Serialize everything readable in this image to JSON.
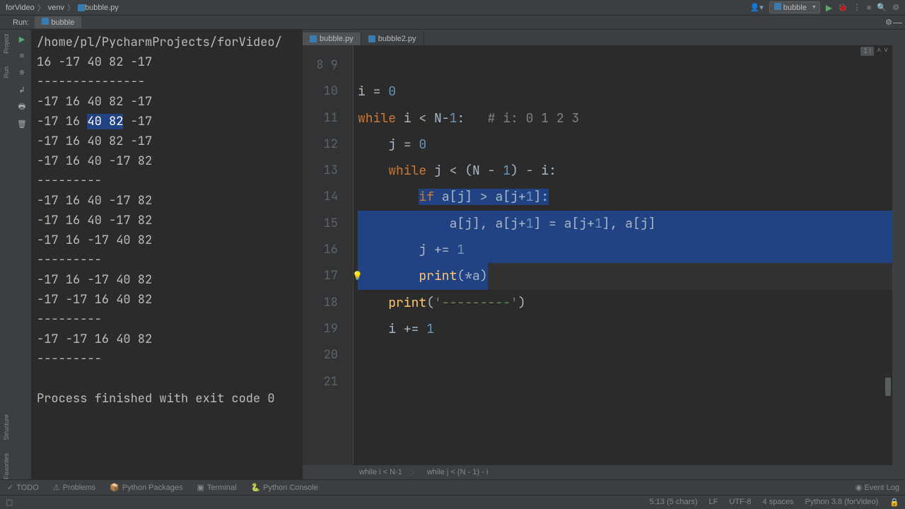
{
  "nav": {
    "crumbs": [
      "forVideo",
      "venv",
      "bubble.py"
    ],
    "config": "bubble"
  },
  "run": {
    "label": "Run:",
    "tab": "bubble"
  },
  "output": {
    "lines": [
      "/home/pl/PycharmProjects/forVideo/",
      "16 -17 40 82 -17",
      "---------------",
      "-17 16 40 82 -17",
      "-17 16 40 82 -17",
      "-17 16 40 82 -17",
      "-17 16 40 -17 82",
      "---------",
      "-17 16 40 -17 82",
      "-17 16 40 -17 82",
      "-17 16 -17 40 82",
      "---------",
      "-17 16 -17 40 82",
      "-17 -17 16 40 82",
      "---------",
      "-17 -17 16 40 82",
      "---------",
      "",
      "Process finished with exit code 0"
    ],
    "selected_line_idx": 4,
    "selected_text": "40 82"
  },
  "editor": {
    "tabs": [
      {
        "label": "bubble.py",
        "active": true
      },
      {
        "label": "bubble2.py",
        "active": false
      }
    ],
    "crumbs": [
      "while i < N-1",
      "while j < (N - 1) - i"
    ],
    "gutter_start": 8,
    "gutter_end": 21,
    "selection_lines": [
      13,
      14,
      15,
      16
    ],
    "caret_line": 16,
    "code_lines": [
      {
        "n": 8,
        "seg": [
          [
            "",
            ""
          ]
        ]
      },
      {
        "n": 9,
        "seg": [
          [
            "id",
            "i "
          ],
          [
            "op",
            "= "
          ],
          [
            "num",
            "0"
          ]
        ]
      },
      {
        "n": 10,
        "seg": [
          [
            "kw",
            "while "
          ],
          [
            "id",
            "i "
          ],
          [
            "op",
            "< "
          ],
          [
            "id",
            "N"
          ],
          [
            "op",
            "-"
          ],
          [
            "num",
            "1"
          ],
          [
            "op",
            ":   "
          ],
          [
            "cmt",
            "# i: 0 1 2 3"
          ]
        ]
      },
      {
        "n": 11,
        "seg": [
          [
            "id",
            "    j "
          ],
          [
            "op",
            "= "
          ],
          [
            "num",
            "0"
          ]
        ]
      },
      {
        "n": 12,
        "seg": [
          [
            "id",
            "    "
          ],
          [
            "kw",
            "while "
          ],
          [
            "id",
            "j "
          ],
          [
            "op",
            "< ("
          ],
          [
            "id",
            "N "
          ],
          [
            "op",
            "- "
          ],
          [
            "num",
            "1"
          ],
          [
            "op",
            ") - "
          ],
          [
            "id",
            "i"
          ],
          [
            "op",
            ":"
          ]
        ]
      },
      {
        "n": 13,
        "seg": [
          [
            "id",
            "        "
          ],
          [
            "kw",
            "if "
          ],
          [
            "id",
            "a"
          ],
          [
            "op",
            "["
          ],
          [
            "id",
            "j"
          ],
          [
            "op",
            "] > "
          ],
          [
            "id",
            "a"
          ],
          [
            "op",
            "["
          ],
          [
            "id",
            "j"
          ],
          [
            "op",
            "+"
          ],
          [
            "num",
            "1"
          ],
          [
            "op",
            "]:"
          ]
        ]
      },
      {
        "n": 14,
        "seg": [
          [
            "id",
            "            a"
          ],
          [
            "op",
            "["
          ],
          [
            "id",
            "j"
          ],
          [
            "op",
            "], "
          ],
          [
            "id",
            "a"
          ],
          [
            "op",
            "["
          ],
          [
            "id",
            "j"
          ],
          [
            "op",
            "+"
          ],
          [
            "num",
            "1"
          ],
          [
            "op",
            "] = "
          ],
          [
            "id",
            "a"
          ],
          [
            "op",
            "["
          ],
          [
            "id",
            "j"
          ],
          [
            "op",
            "+"
          ],
          [
            "num",
            "1"
          ],
          [
            "op",
            "], "
          ],
          [
            "id",
            "a"
          ],
          [
            "op",
            "["
          ],
          [
            "id",
            "j"
          ],
          [
            "op",
            "]"
          ]
        ]
      },
      {
        "n": 15,
        "seg": [
          [
            "id",
            "        j "
          ],
          [
            "op",
            "+= "
          ],
          [
            "num",
            "1"
          ]
        ]
      },
      {
        "n": 16,
        "seg": [
          [
            "id",
            "        "
          ],
          [
            "fn",
            "print"
          ],
          [
            "op",
            "(*"
          ],
          [
            "id",
            "a"
          ],
          [
            "op",
            ")"
          ]
        ]
      },
      {
        "n": 17,
        "seg": [
          [
            "id",
            "    "
          ],
          [
            "fn",
            "print"
          ],
          [
            "op",
            "("
          ],
          [
            "str",
            "'---------'"
          ],
          [
            "op",
            ")"
          ]
        ]
      },
      {
        "n": 18,
        "seg": [
          [
            "id",
            "    i "
          ],
          [
            "op",
            "+= "
          ],
          [
            "num",
            "1"
          ]
        ]
      },
      {
        "n": 19,
        "seg": [
          [
            "",
            ""
          ]
        ]
      },
      {
        "n": 20,
        "seg": [
          [
            "",
            ""
          ]
        ]
      },
      {
        "n": 21,
        "seg": [
          [
            "",
            ""
          ]
        ]
      }
    ]
  },
  "left_tools": {
    "a": "Project",
    "b": "Run",
    "c": "Structure",
    "d": "Favorites"
  },
  "bottom": {
    "tabs": [
      "TODO",
      "Problems",
      "Python Packages",
      "Terminal",
      "Python Console"
    ],
    "event_log": "Event Log"
  },
  "status": {
    "pos": "5:13 (5 chars)",
    "line_end": "LF",
    "encoding": "UTF-8",
    "indent": "4 spaces",
    "interpreter": "Python 3.8 (forVideo)"
  },
  "top_right_badge": "1 !"
}
